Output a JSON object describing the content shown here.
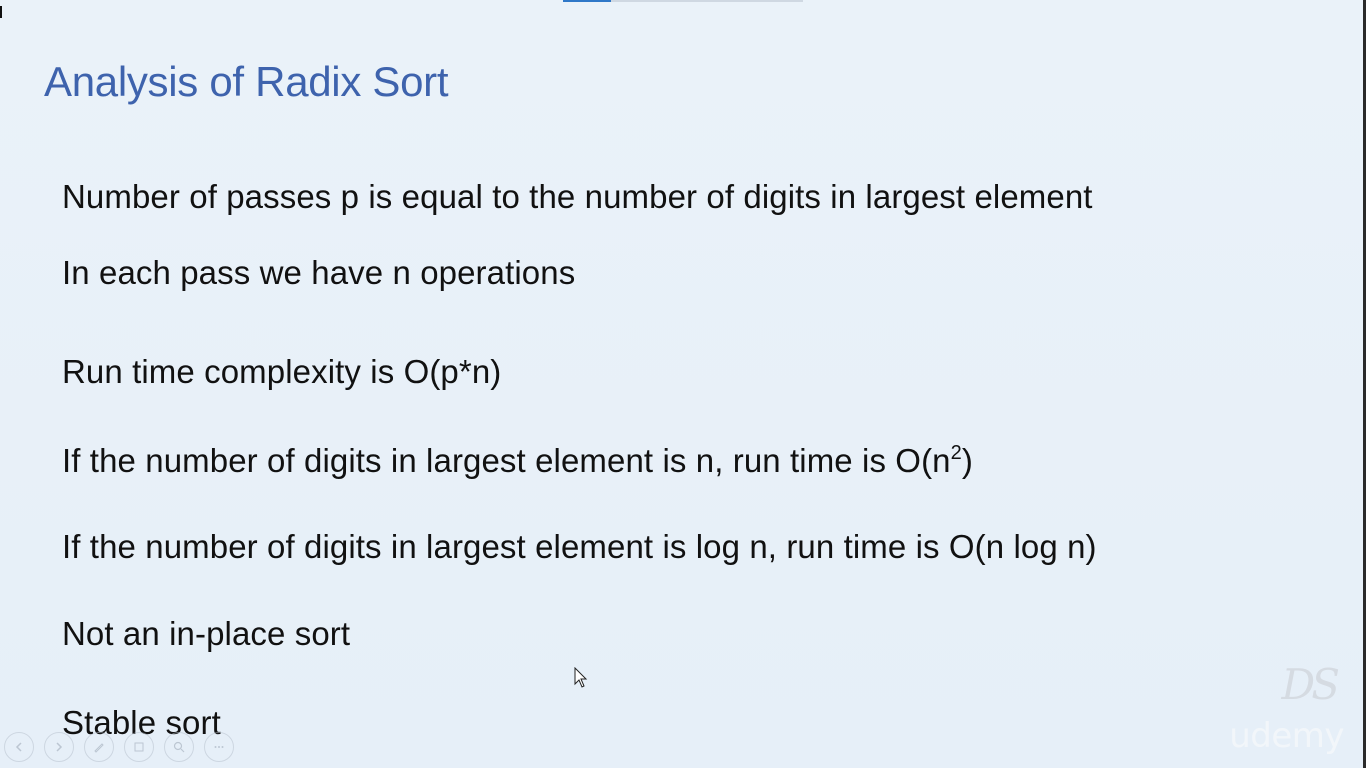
{
  "video": {
    "progress": 0.2
  },
  "slide": {
    "title": "Analysis of Radix Sort",
    "bullets": {
      "b1": "Number of passes p is equal to the number of digits in largest element",
      "b2": "In each pass we have n operations",
      "b3": "Run time complexity is O(p*n)",
      "b4_before": "If the number of digits in largest element is n, run time is O(n",
      "b4_sup": "2",
      "b4_after": ")",
      "b5": "If the number of digits in largest element is log n, run time is O(n log n)",
      "b6": "Not an in-place sort",
      "b7": "Stable sort"
    }
  },
  "controls": {
    "prev_icon": "prev-icon",
    "next_icon": "next-icon",
    "pen_icon": "pen-icon",
    "slides_icon": "slides-icon",
    "zoom_icon": "zoom-icon",
    "more_icon": "more-icon"
  },
  "branding": {
    "watermark": "DS",
    "udemy": "udemy"
  },
  "colors": {
    "title": "#3e63ad",
    "background": "#e9f1f8",
    "progress": "#2f78c8"
  }
}
